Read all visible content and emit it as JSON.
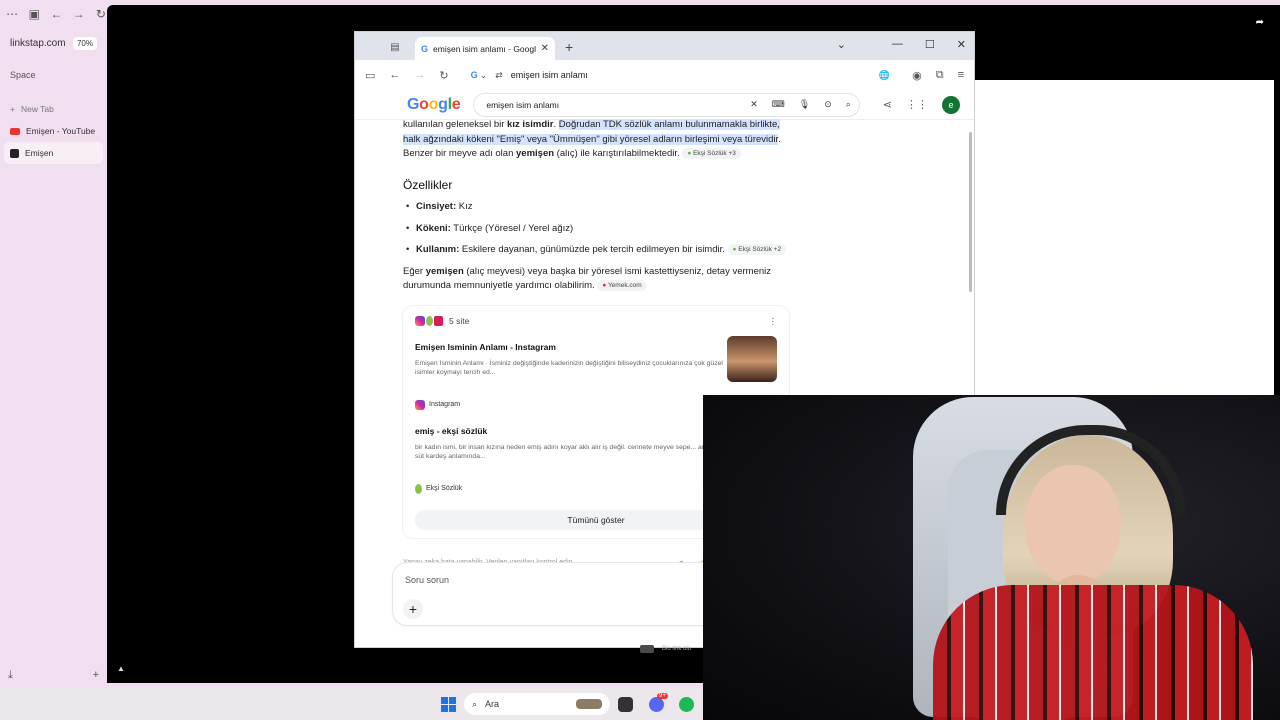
{
  "sidebar": {
    "url": "linkstap.com",
    "zoom": "70%",
    "space": "Space",
    "new_tab": "New Tab",
    "items": [
      {
        "label": "Emişen - YouTube"
      },
      {
        "label": "Emişen"
      }
    ]
  },
  "browser": {
    "tab_title": "emişen isim anlamı - Google'da",
    "address": "emişen isim anlamı"
  },
  "google": {
    "query": "emişen isim anlamı",
    "avatar_letter": "e"
  },
  "content": {
    "intro_a": "kullanılan geleneksel bir ",
    "intro_b": "kız isimdir",
    "intro_c": ". ",
    "intro_hl": "Doğrudan TDK sözlük anlamı bulunmamakla birlikte, halk ağzındaki kökeni \"Emiş\" veya \"Ümmüşen\" gibi yöresel adların birleşimi veya türevidir",
    "intro_d": ". Benzer bir meyve adı olan ",
    "intro_e": "yemişen",
    "intro_f": " (alıç) ile karıştırılabilmektedir.",
    "chip1": "Ekşi Sözlük +3",
    "heading": "Özellikler",
    "features": [
      {
        "label": "Cinsiyet:",
        "value": " Kız",
        "chip": ""
      },
      {
        "label": "Kökeni:",
        "value": " Türkçe (Yöresel / Yerel ağız)",
        "chip": ""
      },
      {
        "label": "Kullanım:",
        "value": " Eskilere dayanan, günümüzde pek tercih edilmeyen bir isimdir.",
        "chip": "Ekşi Sözlük +2"
      }
    ],
    "para2_a": "Eğer ",
    "para2_b": "yemişen",
    "para2_c": " (alıç meyvesi) veya başka bir yöresel ismi kastettiyseniz, detay vermeniz durumunda memnuniyetle yardımcı olabilirim.",
    "chip3": "Yemek.com"
  },
  "sources": {
    "count": "5 site",
    "cards": [
      {
        "title": "Emişen Isminin Anlamı - Instagram",
        "snippet": "Emişen Isminin Anlamı · İsminiz değiştiğinde kaderinizin değiştiğini biliseydiniz çocuklarınıza çok güzel isimler koymayı tercih ed...",
        "site": "Instagram"
      },
      {
        "title": "emiş - ekşi sözlük",
        "snippet": "bir kadın ismi, bir insan kızına neden emiş adını koyar aklı alır iş değil. cennete meyve sepe... anlamı, süt kardeş anlamında...",
        "site": "Ekşi Sözlük"
      }
    ],
    "show_all": "Tümünü göster"
  },
  "disclaimer": "Yapay zeka hata yapabilir. Verilen yanıtları kontrol edin",
  "ask_placeholder": "Soru sorun",
  "biolink": "Bio link olu",
  "taskbar": {
    "search": "Ara",
    "discord_badge": "9+"
  }
}
